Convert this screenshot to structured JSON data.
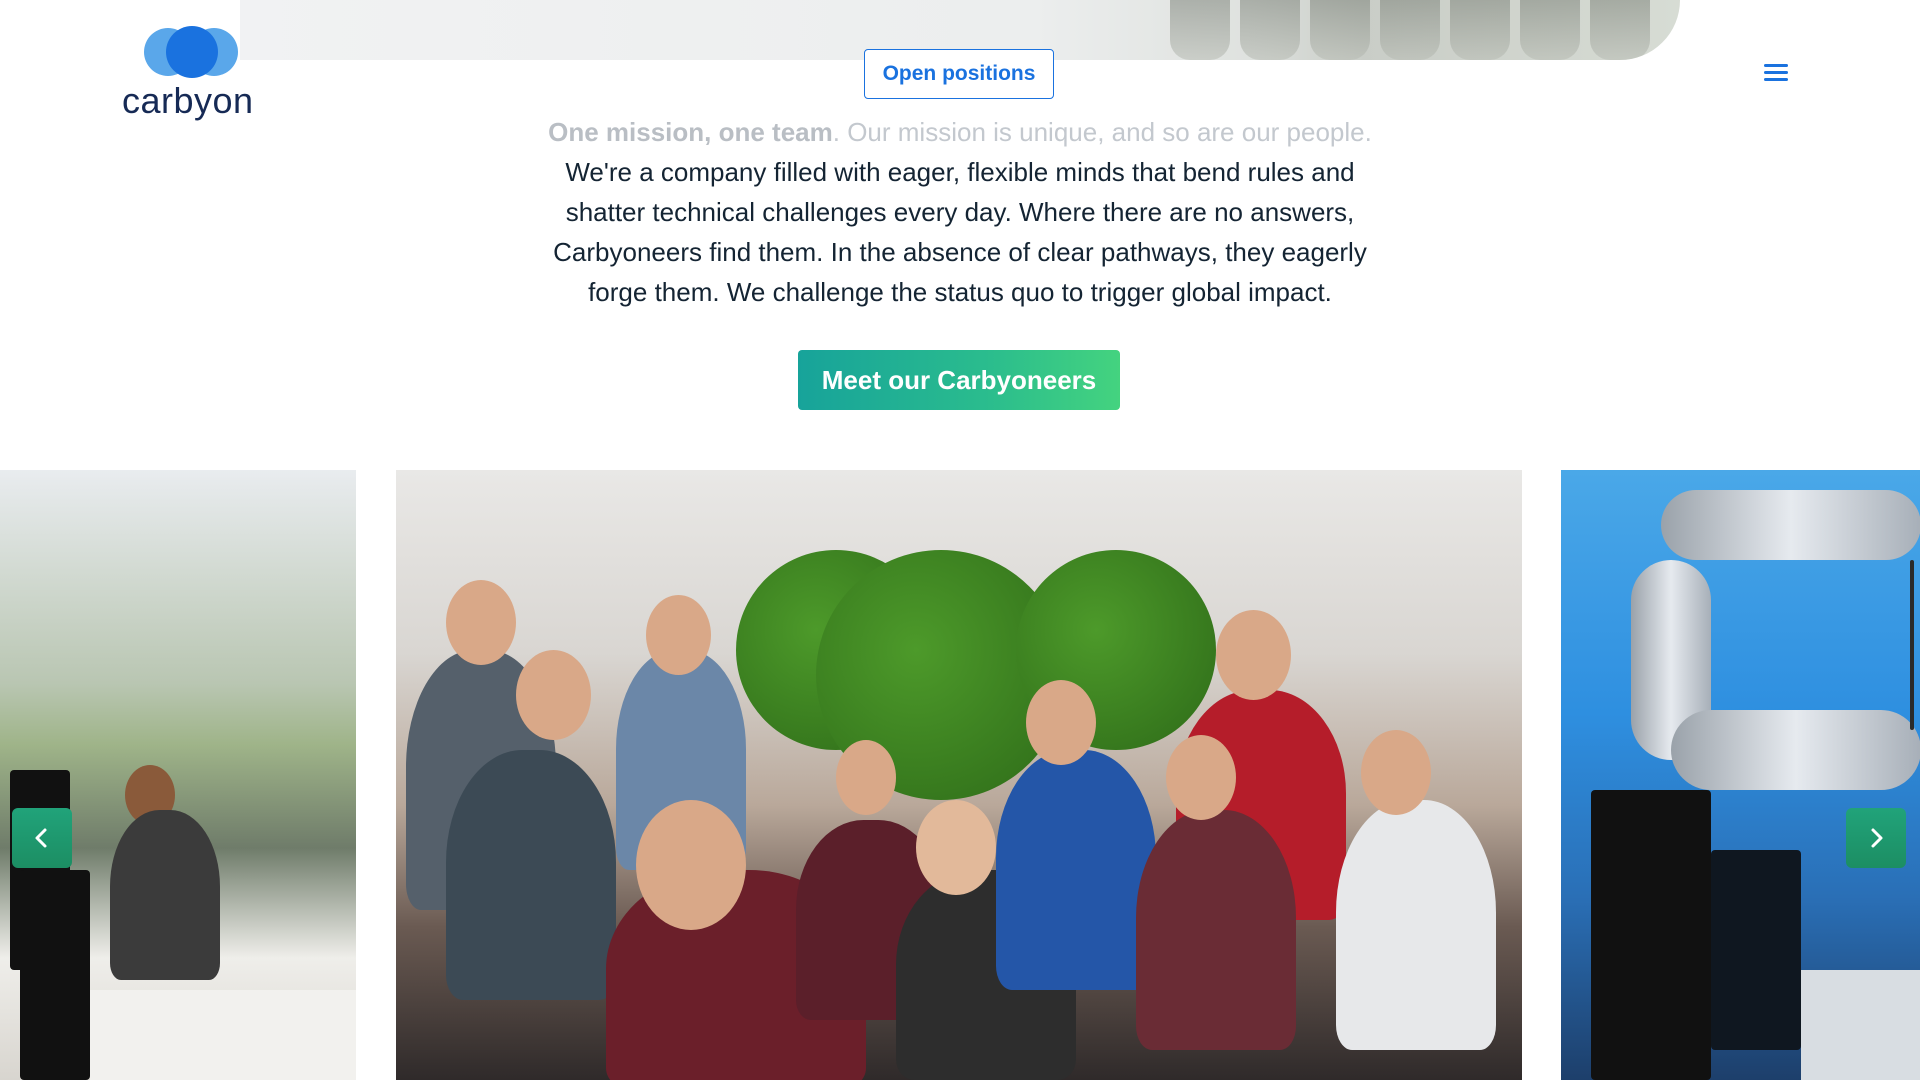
{
  "header": {
    "brand": "carbyon",
    "open_positions_label": "Open positions"
  },
  "intro": {
    "lead_bold": "One mission, one team",
    "lead_rest": ". Our mission is unique, and so are our people.",
    "line2": "We're a company filled with eager, flexible minds that bend rules and",
    "line3": "shatter technical challenges every day. Where there are no answers,",
    "line4": "Carbyoneers find them. In the absence of clear pathways, they eagerly",
    "line5": "forge them. We challenge the status quo to trigger global impact."
  },
  "cta": {
    "label": "Meet our Carbyoneers"
  },
  "carousel": {
    "prev_icon": "chevron-left-icon",
    "next_icon": "chevron-right-icon"
  },
  "colors": {
    "brand_blue": "#1a72df",
    "light_blue": "#5aa7ea",
    "cta_start": "#17a39a",
    "cta_end": "#44d37f",
    "nav_green": "#21a37a",
    "text_dark": "#142433"
  }
}
